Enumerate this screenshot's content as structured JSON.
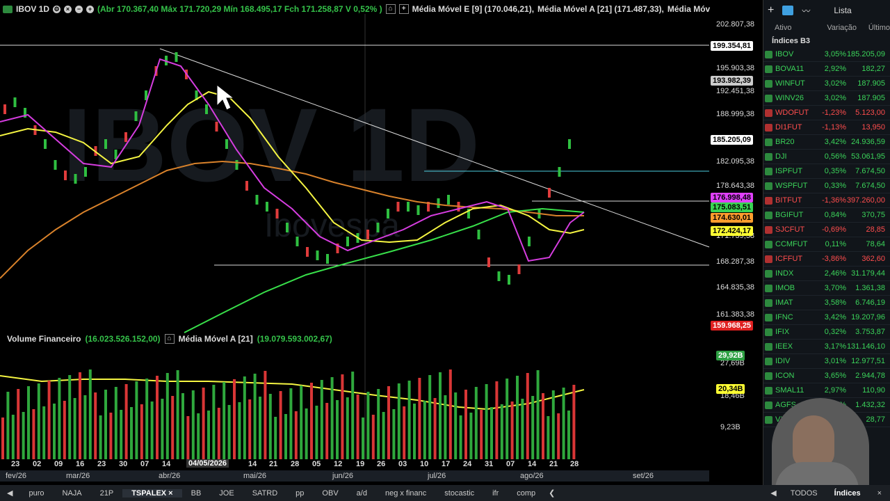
{
  "header": {
    "symbol": "IBOV 1D",
    "ohlc_text": "(Abr 170.367,40 Máx 171.720,29 Mín 168.495,17 Fch 171.258,87 V 0,52% )",
    "ema9": "Média Móvel E [9] (170.046,21),",
    "ema21": "Média Móvel A [21] (171.487,33),",
    "trail": "Média Móv"
  },
  "watermark": "IBOV 1D",
  "watermark_sub": "Ibovespa",
  "price_axis": [
    "202.807,38",
    "195.903,38",
    "192.451,38",
    "188.999,38",
    "182.095,38",
    "178.643,38",
    "171.739,38",
    "168.287,38",
    "164.835,38",
    "161.383,38"
  ],
  "price_tags": [
    {
      "label": "199.354,81",
      "bg": "#ffffff",
      "fg": "#000000"
    },
    {
      "label": "193.982,39",
      "bg": "#cccccc",
      "fg": "#000000"
    },
    {
      "label": "185.205,09",
      "bg": "#ffffff",
      "fg": "#000000"
    },
    {
      "label": "176.998,48",
      "bg": "#e040fb",
      "fg": "#000000"
    },
    {
      "label": "175.083,51",
      "bg": "#39d353",
      "fg": "#000000"
    },
    {
      "label": "174.630,01",
      "bg": "#ff9d2e",
      "fg": "#000000"
    },
    {
      "label": "172.424,17",
      "bg": "#ffff33",
      "fg": "#000000"
    },
    {
      "label": "159.968,25",
      "bg": "#e02020",
      "fg": "#ffffff"
    }
  ],
  "volume": {
    "title": "Volume Financeiro",
    "value": "(16.023.526.152,00)",
    "ma_label": "Média Móvel A [21]",
    "ma_value": "(19.079.593.002,67)",
    "axis": [
      "27,69B",
      "18,46B",
      "9,23B"
    ],
    "tags": [
      {
        "label": "29,92B",
        "bg": "#2ea043",
        "fg": "#ffffff"
      },
      {
        "label": "20,34B",
        "bg": "#ffff33",
        "fg": "#000000"
      }
    ]
  },
  "time_axis": [
    "23",
    "02",
    "09",
    "16",
    "23",
    "30",
    "07",
    "14",
    "28",
    "14",
    "21",
    "28",
    "05",
    "12",
    "19",
    "26",
    "03",
    "10",
    "17",
    "24",
    "31",
    "07",
    "14",
    "21",
    "28"
  ],
  "date_cursor": "04/05/2026",
  "months": [
    "fev/26",
    "mar/26",
    "abr/26",
    "mai/26",
    "jun/26",
    "jul/26",
    "ago/26",
    "set/26"
  ],
  "tabs": [
    "puro",
    "NAJA",
    "21P",
    "TSPALEX",
    "BB",
    "JOE",
    "SATRD",
    "pp",
    "OBV",
    "a/d",
    "neg x financ",
    "stocastic",
    "ifr",
    "comp"
  ],
  "active_tab": "TSPALEX",
  "panel": {
    "top_list": "Lista",
    "columns": [
      "Ativo",
      "Variação",
      "Último"
    ],
    "group": "Índices B3",
    "rows": [
      {
        "sym": "IBOV",
        "chg": "3,05%",
        "last": "185.205,09",
        "dir": "pos"
      },
      {
        "sym": "BOVA11",
        "chg": "2,92%",
        "last": "182,27",
        "dir": "pos"
      },
      {
        "sym": "WINFUT",
        "chg": "3,02%",
        "last": "187.905",
        "dir": "pos"
      },
      {
        "sym": "WINV26",
        "chg": "3,02%",
        "last": "187.905",
        "dir": "pos"
      },
      {
        "sym": "WDOFUT",
        "chg": "-1,23%",
        "last": "5.123,00",
        "dir": "neg"
      },
      {
        "sym": "DI1FUT",
        "chg": "-1,13%",
        "last": "13,950",
        "dir": "neg"
      },
      {
        "sym": "BR20",
        "chg": "3,42%",
        "last": "24.936,59",
        "dir": "pos"
      },
      {
        "sym": "DJI",
        "chg": "0,56%",
        "last": "53.061,95",
        "dir": "pos"
      },
      {
        "sym": "ISPFUT",
        "chg": "0,35%",
        "last": "7.674,50",
        "dir": "pos"
      },
      {
        "sym": "WSPFUT",
        "chg": "0,33%",
        "last": "7.674,50",
        "dir": "pos"
      },
      {
        "sym": "BITFUT",
        "chg": "-1,36%",
        "last": "397.260,00",
        "dir": "neg"
      },
      {
        "sym": "BGIFUT",
        "chg": "0,84%",
        "last": "370,75",
        "dir": "pos"
      },
      {
        "sym": "SJCFUT",
        "chg": "-0,69%",
        "last": "28,85",
        "dir": "neg"
      },
      {
        "sym": "CCMFUT",
        "chg": "0,11%",
        "last": "78,64",
        "dir": "pos"
      },
      {
        "sym": "ICFFUT",
        "chg": "-3,86%",
        "last": "362,60",
        "dir": "neg"
      },
      {
        "sym": "INDX",
        "chg": "2,46%",
        "last": "31.179,44",
        "dir": "pos"
      },
      {
        "sym": "IMOB",
        "chg": "3,70%",
        "last": "1.361,38",
        "dir": "pos"
      },
      {
        "sym": "IMAT",
        "chg": "3,58%",
        "last": "6.746,19",
        "dir": "pos"
      },
      {
        "sym": "IFNC",
        "chg": "3,42%",
        "last": "19.207,96",
        "dir": "pos"
      },
      {
        "sym": "IFIX",
        "chg": "0,32%",
        "last": "3.753,87",
        "dir": "pos"
      },
      {
        "sym": "IEEX",
        "chg": "3,17%",
        "last": "131.146,10",
        "dir": "pos"
      },
      {
        "sym": "IDIV",
        "chg": "3,01%",
        "last": "12.977,51",
        "dir": "pos"
      },
      {
        "sym": "ICON",
        "chg": "3,65%",
        "last": "2.944,78",
        "dir": "pos"
      },
      {
        "sym": "SMAL11",
        "chg": "2,97%",
        "last": "110,90",
        "dir": "pos"
      },
      {
        "sym": "AGFS",
        "chg": "1,72%",
        "last": "1.432,32",
        "dir": "pos"
      },
      {
        "sym": "VXBR",
        "chg": "",
        "last": "28,77",
        "dir": "pos"
      }
    ],
    "bottom_tabs": [
      "TODOS",
      "Índices"
    ]
  }
}
